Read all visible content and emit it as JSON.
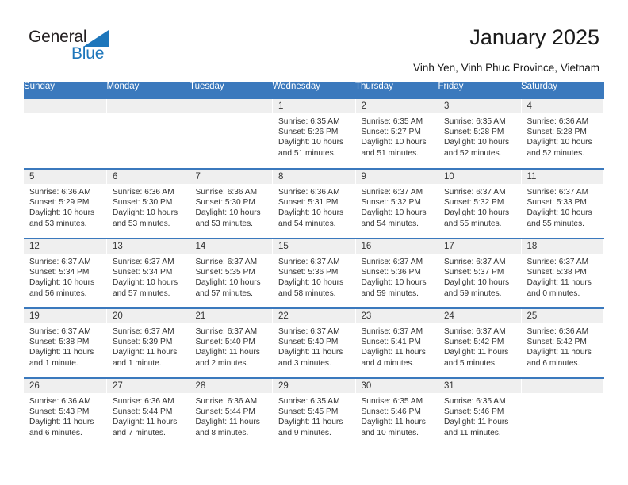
{
  "logo": {
    "word_one": "General",
    "word_two": "Blue",
    "triangle_color": "#1d76bb",
    "text_color": "#231f20"
  },
  "header": {
    "title": "January 2025",
    "subtitle": "Vinh Yen, Vinh Phuc Province, Vietnam"
  },
  "theme": {
    "header_row_bg": "#3b79bd",
    "header_row_text": "#ffffff",
    "day_band_bg": "#efefef",
    "week_separator": "#3b79bd",
    "body_text": "#333333"
  },
  "calendar": {
    "weekday_headers": [
      "Sunday",
      "Monday",
      "Tuesday",
      "Wednesday",
      "Thursday",
      "Friday",
      "Saturday"
    ],
    "labels": {
      "sunrise": "Sunrise:",
      "sunset": "Sunset:",
      "daylight": "Daylight:"
    },
    "weeks": [
      [
        {
          "day": "",
          "empty": true
        },
        {
          "day": "",
          "empty": true
        },
        {
          "day": "",
          "empty": true
        },
        {
          "day": "1",
          "sunrise": "Sunrise: 6:35 AM",
          "sunset": "Sunset: 5:26 PM",
          "daylight_line1": "Daylight: 10 hours",
          "daylight_line2": "and 51 minutes."
        },
        {
          "day": "2",
          "sunrise": "Sunrise: 6:35 AM",
          "sunset": "Sunset: 5:27 PM",
          "daylight_line1": "Daylight: 10 hours",
          "daylight_line2": "and 51 minutes."
        },
        {
          "day": "3",
          "sunrise": "Sunrise: 6:35 AM",
          "sunset": "Sunset: 5:28 PM",
          "daylight_line1": "Daylight: 10 hours",
          "daylight_line2": "and 52 minutes."
        },
        {
          "day": "4",
          "sunrise": "Sunrise: 6:36 AM",
          "sunset": "Sunset: 5:28 PM",
          "daylight_line1": "Daylight: 10 hours",
          "daylight_line2": "and 52 minutes."
        }
      ],
      [
        {
          "day": "5",
          "sunrise": "Sunrise: 6:36 AM",
          "sunset": "Sunset: 5:29 PM",
          "daylight_line1": "Daylight: 10 hours",
          "daylight_line2": "and 53 minutes."
        },
        {
          "day": "6",
          "sunrise": "Sunrise: 6:36 AM",
          "sunset": "Sunset: 5:30 PM",
          "daylight_line1": "Daylight: 10 hours",
          "daylight_line2": "and 53 minutes."
        },
        {
          "day": "7",
          "sunrise": "Sunrise: 6:36 AM",
          "sunset": "Sunset: 5:30 PM",
          "daylight_line1": "Daylight: 10 hours",
          "daylight_line2": "and 53 minutes."
        },
        {
          "day": "8",
          "sunrise": "Sunrise: 6:36 AM",
          "sunset": "Sunset: 5:31 PM",
          "daylight_line1": "Daylight: 10 hours",
          "daylight_line2": "and 54 minutes."
        },
        {
          "day": "9",
          "sunrise": "Sunrise: 6:37 AM",
          "sunset": "Sunset: 5:32 PM",
          "daylight_line1": "Daylight: 10 hours",
          "daylight_line2": "and 54 minutes."
        },
        {
          "day": "10",
          "sunrise": "Sunrise: 6:37 AM",
          "sunset": "Sunset: 5:32 PM",
          "daylight_line1": "Daylight: 10 hours",
          "daylight_line2": "and 55 minutes."
        },
        {
          "day": "11",
          "sunrise": "Sunrise: 6:37 AM",
          "sunset": "Sunset: 5:33 PM",
          "daylight_line1": "Daylight: 10 hours",
          "daylight_line2": "and 55 minutes."
        }
      ],
      [
        {
          "day": "12",
          "sunrise": "Sunrise: 6:37 AM",
          "sunset": "Sunset: 5:34 PM",
          "daylight_line1": "Daylight: 10 hours",
          "daylight_line2": "and 56 minutes."
        },
        {
          "day": "13",
          "sunrise": "Sunrise: 6:37 AM",
          "sunset": "Sunset: 5:34 PM",
          "daylight_line1": "Daylight: 10 hours",
          "daylight_line2": "and 57 minutes."
        },
        {
          "day": "14",
          "sunrise": "Sunrise: 6:37 AM",
          "sunset": "Sunset: 5:35 PM",
          "daylight_line1": "Daylight: 10 hours",
          "daylight_line2": "and 57 minutes."
        },
        {
          "day": "15",
          "sunrise": "Sunrise: 6:37 AM",
          "sunset": "Sunset: 5:36 PM",
          "daylight_line1": "Daylight: 10 hours",
          "daylight_line2": "and 58 minutes."
        },
        {
          "day": "16",
          "sunrise": "Sunrise: 6:37 AM",
          "sunset": "Sunset: 5:36 PM",
          "daylight_line1": "Daylight: 10 hours",
          "daylight_line2": "and 59 minutes."
        },
        {
          "day": "17",
          "sunrise": "Sunrise: 6:37 AM",
          "sunset": "Sunset: 5:37 PM",
          "daylight_line1": "Daylight: 10 hours",
          "daylight_line2": "and 59 minutes."
        },
        {
          "day": "18",
          "sunrise": "Sunrise: 6:37 AM",
          "sunset": "Sunset: 5:38 PM",
          "daylight_line1": "Daylight: 11 hours",
          "daylight_line2": "and 0 minutes."
        }
      ],
      [
        {
          "day": "19",
          "sunrise": "Sunrise: 6:37 AM",
          "sunset": "Sunset: 5:38 PM",
          "daylight_line1": "Daylight: 11 hours",
          "daylight_line2": "and 1 minute."
        },
        {
          "day": "20",
          "sunrise": "Sunrise: 6:37 AM",
          "sunset": "Sunset: 5:39 PM",
          "daylight_line1": "Daylight: 11 hours",
          "daylight_line2": "and 1 minute."
        },
        {
          "day": "21",
          "sunrise": "Sunrise: 6:37 AM",
          "sunset": "Sunset: 5:40 PM",
          "daylight_line1": "Daylight: 11 hours",
          "daylight_line2": "and 2 minutes."
        },
        {
          "day": "22",
          "sunrise": "Sunrise: 6:37 AM",
          "sunset": "Sunset: 5:40 PM",
          "daylight_line1": "Daylight: 11 hours",
          "daylight_line2": "and 3 minutes."
        },
        {
          "day": "23",
          "sunrise": "Sunrise: 6:37 AM",
          "sunset": "Sunset: 5:41 PM",
          "daylight_line1": "Daylight: 11 hours",
          "daylight_line2": "and 4 minutes."
        },
        {
          "day": "24",
          "sunrise": "Sunrise: 6:37 AM",
          "sunset": "Sunset: 5:42 PM",
          "daylight_line1": "Daylight: 11 hours",
          "daylight_line2": "and 5 minutes."
        },
        {
          "day": "25",
          "sunrise": "Sunrise: 6:36 AM",
          "sunset": "Sunset: 5:42 PM",
          "daylight_line1": "Daylight: 11 hours",
          "daylight_line2": "and 6 minutes."
        }
      ],
      [
        {
          "day": "26",
          "sunrise": "Sunrise: 6:36 AM",
          "sunset": "Sunset: 5:43 PM",
          "daylight_line1": "Daylight: 11 hours",
          "daylight_line2": "and 6 minutes."
        },
        {
          "day": "27",
          "sunrise": "Sunrise: 6:36 AM",
          "sunset": "Sunset: 5:44 PM",
          "daylight_line1": "Daylight: 11 hours",
          "daylight_line2": "and 7 minutes."
        },
        {
          "day": "28",
          "sunrise": "Sunrise: 6:36 AM",
          "sunset": "Sunset: 5:44 PM",
          "daylight_line1": "Daylight: 11 hours",
          "daylight_line2": "and 8 minutes."
        },
        {
          "day": "29",
          "sunrise": "Sunrise: 6:35 AM",
          "sunset": "Sunset: 5:45 PM",
          "daylight_line1": "Daylight: 11 hours",
          "daylight_line2": "and 9 minutes."
        },
        {
          "day": "30",
          "sunrise": "Sunrise: 6:35 AM",
          "sunset": "Sunset: 5:46 PM",
          "daylight_line1": "Daylight: 11 hours",
          "daylight_line2": "and 10 minutes."
        },
        {
          "day": "31",
          "sunrise": "Sunrise: 6:35 AM",
          "sunset": "Sunset: 5:46 PM",
          "daylight_line1": "Daylight: 11 hours",
          "daylight_line2": "and 11 minutes."
        },
        {
          "day": "",
          "empty": true
        }
      ]
    ]
  }
}
